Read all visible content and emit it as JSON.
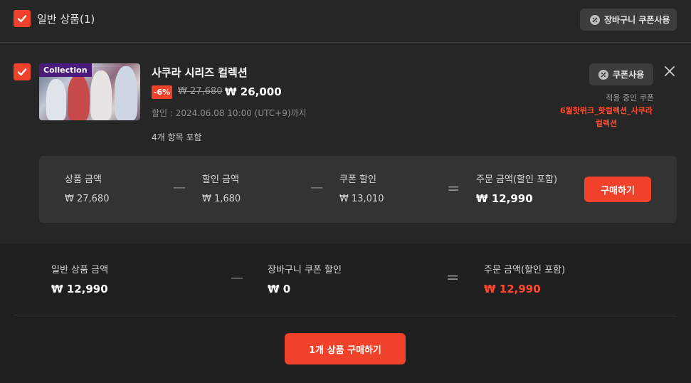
{
  "header": {
    "title": "일반 상품(1)",
    "cart_coupon_label": "장바구니 쿠폰사용"
  },
  "item": {
    "thumbnail_tag": "Collection",
    "title": "사쿠라 시리즈 컬렉션",
    "discount": "-6%",
    "original_price": "₩ 27,680",
    "sale_price": "₩ 26,000",
    "sale_period": "할인 : 2024.06.08 10:00 (UTC+9)까지",
    "included": "4개 항목 포함",
    "coupon_label": "쿠폰사용",
    "applied_coupon_label": "적용 중인 쿠폰",
    "applied_coupon_name": "6월핫위크_핫컬렉션_사쿠라컬렉션",
    "calc": {
      "product_amount_label": "상품 금액",
      "product_amount": "₩ 27,680",
      "discount_amount_label": "할인 금액",
      "discount_amount": "₩ 1,680",
      "coupon_discount_label": "쿠폰 할인",
      "coupon_discount": "₩ 13,010",
      "order_amount_label": "주문 금액(할인 포함)",
      "order_amount": "₩ 12,990",
      "minus": "—",
      "equals": "=",
      "buy_label": "구매하기"
    }
  },
  "summary": {
    "general_amount_label": "일반 상품 금액",
    "general_amount": "₩ 12,990",
    "cart_coupon_discount_label": "장바구니 쿠폰 할인",
    "cart_coupon_discount": "₩ 0",
    "order_amount_label": "주문 금액(할인 포함)",
    "order_amount": "₩ 12,990",
    "minus": "—",
    "equals": "=",
    "buy_all_label": "1개 상품 구매하기"
  },
  "colors": {
    "accent": "#f0412a",
    "background": "#262626",
    "panel": "#333333",
    "summary_bg": "#1f1f1f"
  }
}
